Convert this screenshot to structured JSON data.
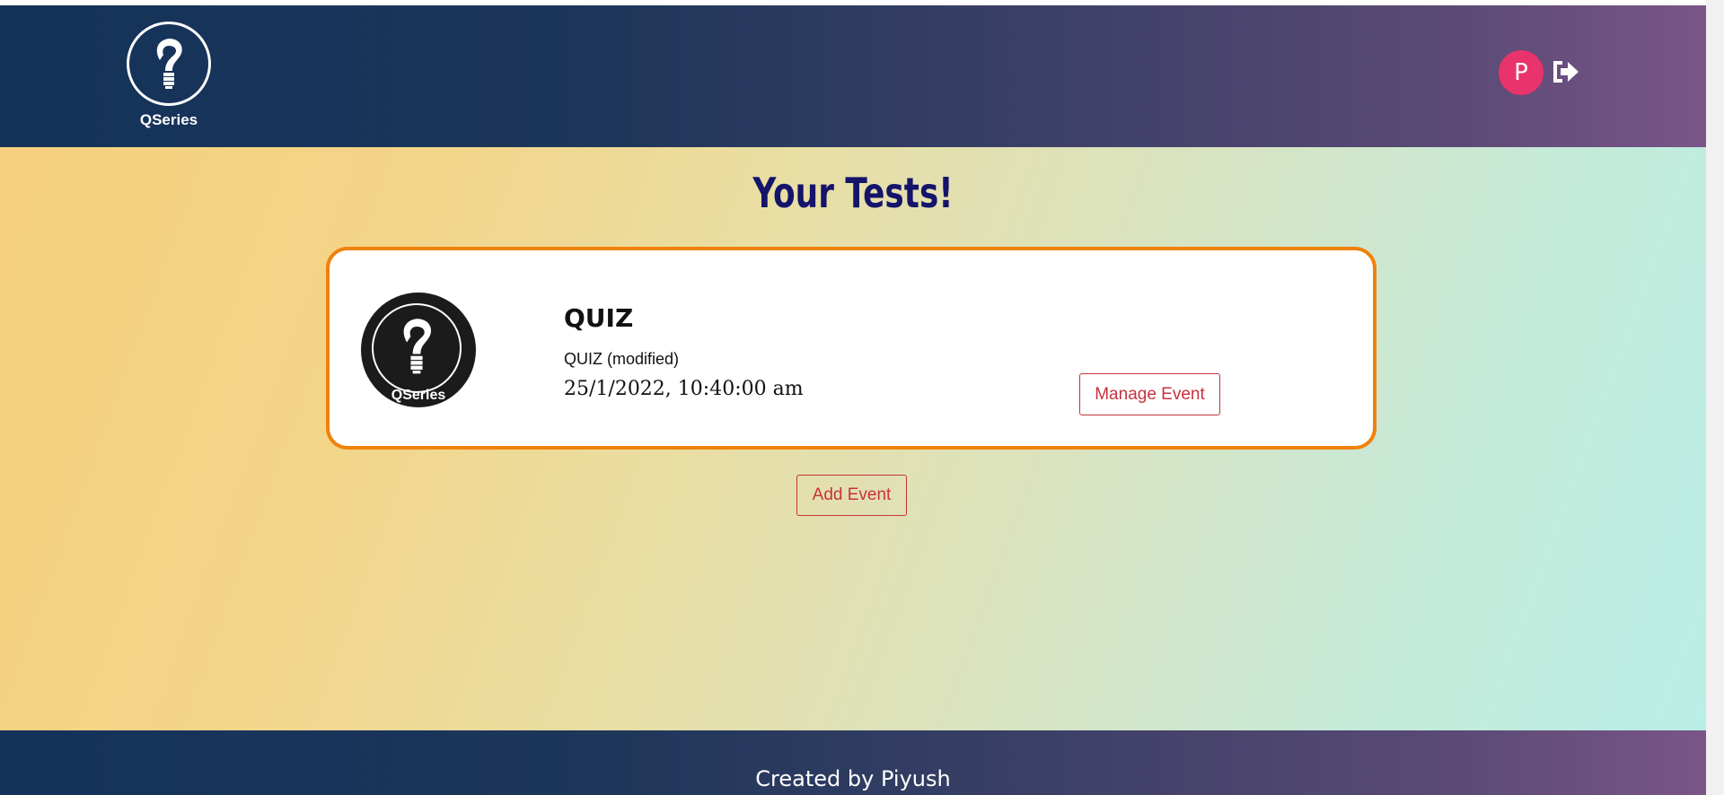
{
  "header": {
    "brand_name": "QSeries",
    "avatar_initial": "P"
  },
  "main": {
    "title": "Your Tests!",
    "add_event_label": "Add Event",
    "tests": [
      {
        "name": "QUIZ",
        "description": "QUIZ (modified)",
        "datetime": "25/1/2022, 10:40:00 am",
        "logo_text": "QSeries",
        "manage_label": "Manage Event"
      }
    ]
  },
  "footer": {
    "text": "Created by Piyush"
  },
  "colors": {
    "accent_orange": "#f0820c",
    "button_red": "#c8323c",
    "avatar_pink": "#e8336c",
    "title_navy": "#14146b"
  },
  "icons": {
    "brand": "question-bulb-icon",
    "logout": "sign-out-icon"
  }
}
